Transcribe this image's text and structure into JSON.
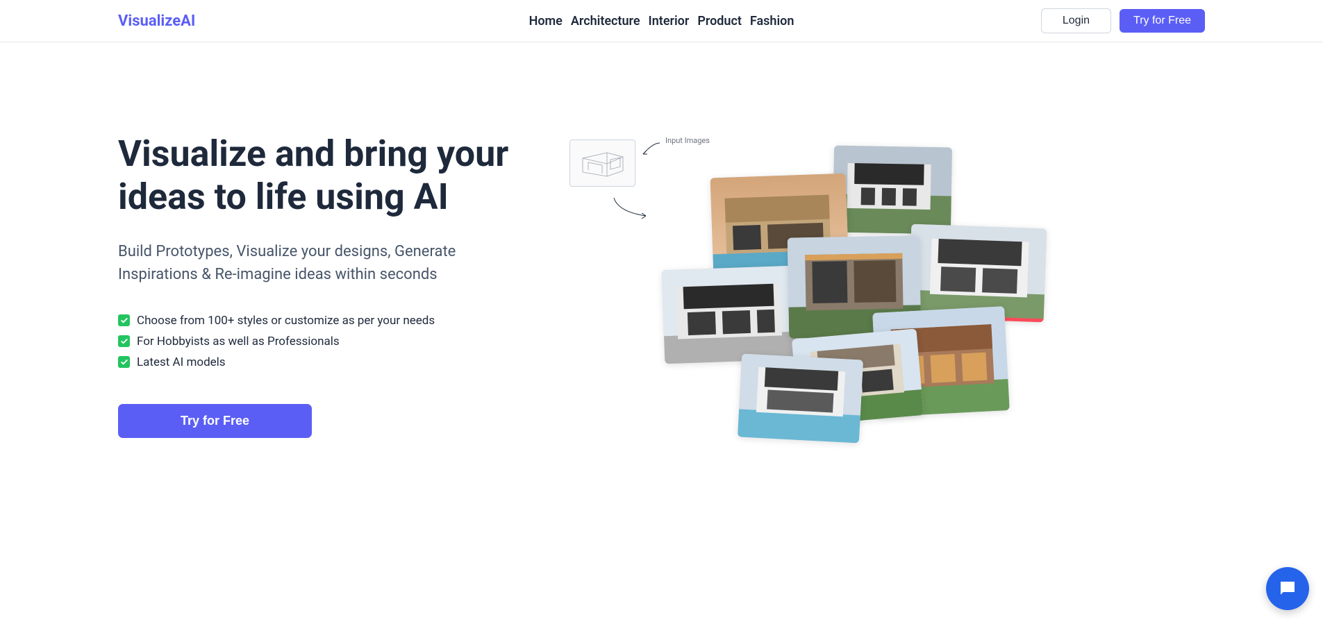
{
  "header": {
    "logo": "VisualizeAI",
    "nav": {
      "home": "Home",
      "architecture": "Architecture",
      "interior": "Interior",
      "product": "Product",
      "fashion": "Fashion"
    },
    "login": "Login",
    "try_free": "Try for Free"
  },
  "hero": {
    "title": "Visualize and bring your ideas to life using AI",
    "subtitle": "Build Prototypes, Visualize your designs, Generate Inspirations & Re-imagine ideas within seconds",
    "features": {
      "f1": "Choose from 100+ styles or customize as per your needs",
      "f2": "For Hobbyists as well as Professionals",
      "f3": "Latest AI models"
    },
    "cta": "Try for Free",
    "input_label": "Input Images"
  }
}
